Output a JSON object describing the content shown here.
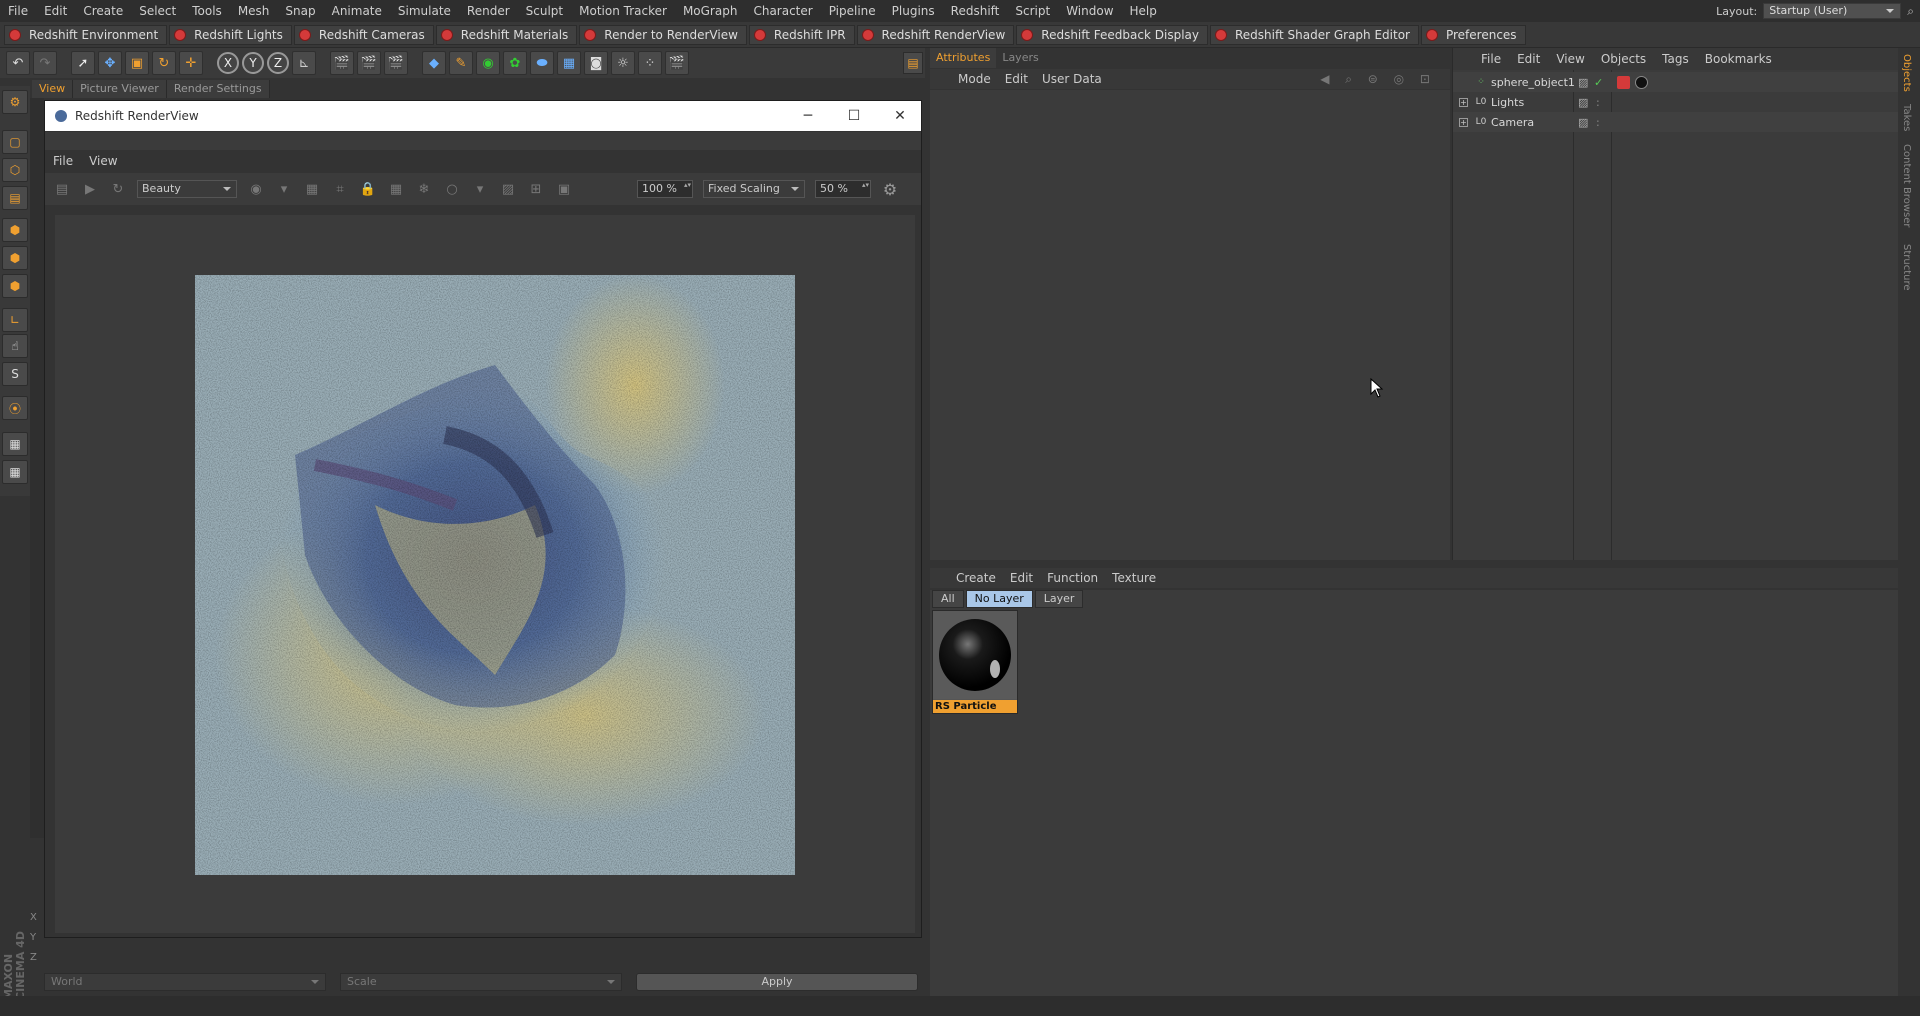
{
  "menubar": {
    "items": [
      "File",
      "Edit",
      "Create",
      "Select",
      "Tools",
      "Mesh",
      "Snap",
      "Animate",
      "Simulate",
      "Render",
      "Sculpt",
      "Motion Tracker",
      "MoGraph",
      "Character",
      "Pipeline",
      "Plugins",
      "Redshift",
      "Script",
      "Window",
      "Help"
    ],
    "layout_label": "Layout:",
    "layout_value": "Startup (User)"
  },
  "palette": {
    "items": [
      "Redshift Environment",
      "Redshift Lights",
      "Redshift Cameras",
      "Redshift Materials",
      "Render to RenderView",
      "Redshift IPR",
      "Redshift RenderView",
      "Redshift Feedback Display",
      "Redshift Shader Graph Editor",
      "Preferences"
    ]
  },
  "viewtabs": [
    "View",
    "Picture Viewer",
    "Render Settings"
  ],
  "renderview": {
    "title": "Redshift RenderView",
    "menu": [
      "File",
      "View"
    ],
    "aov": "Beauty",
    "zoom": "100 %",
    "scaling": "Fixed Scaling",
    "scale_pct": "50 %"
  },
  "attributes": {
    "tabs": [
      "Attributes",
      "Layers"
    ],
    "menu": [
      "Mode",
      "Edit",
      "User Data"
    ]
  },
  "objects": {
    "menu": [
      "File",
      "Edit",
      "View",
      "Objects",
      "Tags",
      "Bookmarks"
    ],
    "rows": [
      {
        "name": "sphere_object1"
      },
      {
        "name": "Lights"
      },
      {
        "name": "Camera"
      }
    ]
  },
  "sidetabs": [
    "Objects",
    "Takes",
    "Content Browser",
    "Structure"
  ],
  "materials": {
    "menu": [
      "Create",
      "Edit",
      "Function",
      "Texture"
    ],
    "tabs": [
      "All",
      "No Layer",
      "Layer"
    ],
    "material_name": "RS Particle"
  },
  "coords": {
    "space": "World",
    "mode": "Scale",
    "apply": "Apply",
    "axes": [
      "X",
      "Y",
      "Z"
    ]
  },
  "brand": "MAXON CINEMA 4D",
  "colors": {
    "accent": "#f0a030",
    "redshift_red": "#d43a3a",
    "render_bg": "#9aaeb7"
  },
  "icons": {
    "close": "close-icon",
    "maximize": "maximize-icon",
    "minimize": "minimize-icon",
    "settings": "gear-icon"
  }
}
